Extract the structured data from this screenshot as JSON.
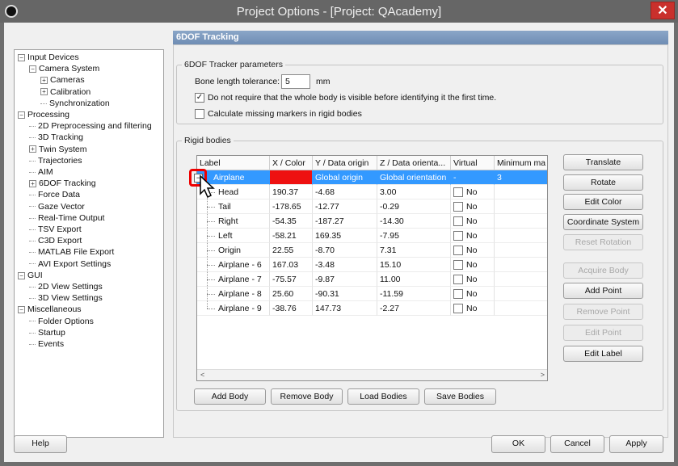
{
  "window": {
    "title": "Project Options - [Project: QAcademy]"
  },
  "panel_header": "6DOF Tracking",
  "tree": {
    "items": [
      {
        "label": "Input Devices",
        "level": 0,
        "exp": "−"
      },
      {
        "label": "Camera System",
        "level": 1,
        "exp": "−"
      },
      {
        "label": "Cameras",
        "level": 2,
        "exp": "+"
      },
      {
        "label": "Calibration",
        "level": 2,
        "exp": "+"
      },
      {
        "label": "Synchronization",
        "level": 2,
        "exp": ""
      },
      {
        "label": "Processing",
        "level": 0,
        "exp": "−"
      },
      {
        "label": "2D Preprocessing and filtering",
        "level": 1,
        "exp": ""
      },
      {
        "label": "3D Tracking",
        "level": 1,
        "exp": ""
      },
      {
        "label": "Twin System",
        "level": 1,
        "exp": "+"
      },
      {
        "label": "Trajectories",
        "level": 1,
        "exp": ""
      },
      {
        "label": "AIM",
        "level": 1,
        "exp": ""
      },
      {
        "label": "6DOF Tracking",
        "level": 1,
        "exp": "+"
      },
      {
        "label": "Force Data",
        "level": 1,
        "exp": ""
      },
      {
        "label": "Gaze Vector",
        "level": 1,
        "exp": ""
      },
      {
        "label": "Real-Time Output",
        "level": 1,
        "exp": ""
      },
      {
        "label": "TSV Export",
        "level": 1,
        "exp": ""
      },
      {
        "label": "C3D Export",
        "level": 1,
        "exp": ""
      },
      {
        "label": "MATLAB File Export",
        "level": 1,
        "exp": ""
      },
      {
        "label": "AVI Export Settings",
        "level": 1,
        "exp": ""
      },
      {
        "label": "GUI",
        "level": 0,
        "exp": "−"
      },
      {
        "label": "2D View Settings",
        "level": 1,
        "exp": ""
      },
      {
        "label": "3D View Settings",
        "level": 1,
        "exp": ""
      },
      {
        "label": "Miscellaneous",
        "level": 0,
        "exp": "−"
      },
      {
        "label": "Folder Options",
        "level": 1,
        "exp": ""
      },
      {
        "label": "Startup",
        "level": 1,
        "exp": ""
      },
      {
        "label": "Events",
        "level": 1,
        "exp": ""
      }
    ]
  },
  "tracker_params": {
    "legend": "6DOF Tracker parameters",
    "bone_label": "Bone length tolerance:",
    "bone_value": "5",
    "bone_unit": "mm",
    "opt1_label": "Do not require that the whole body is visible before identifying it the first time.",
    "opt1_checked": true,
    "opt2_label": "Calculate missing markers in rigid bodies",
    "opt2_checked": false
  },
  "rigid_bodies": {
    "legend": "Rigid bodies",
    "columns": [
      "Label",
      "X / Color",
      "Y / Data origin",
      "Z / Data orienta...",
      "Virtual",
      "Minimum ma"
    ],
    "body": {
      "label": "Airplane",
      "x": "",
      "y": "Global origin",
      "z": "Global orientation",
      "virtual": "-",
      "min": "3",
      "color": "#ee1111"
    },
    "points": [
      {
        "label": "Head",
        "x": "190.37",
        "y": "-4.68",
        "z": "3.00",
        "virtual": "No"
      },
      {
        "label": "Tail",
        "x": "-178.65",
        "y": "-12.77",
        "z": "-0.29",
        "virtual": "No"
      },
      {
        "label": "Right",
        "x": "-54.35",
        "y": "-187.27",
        "z": "-14.30",
        "virtual": "No"
      },
      {
        "label": "Left",
        "x": "-58.21",
        "y": "169.35",
        "z": "-7.95",
        "virtual": "No"
      },
      {
        "label": "Origin",
        "x": "22.55",
        "y": "-8.70",
        "z": "7.31",
        "virtual": "No"
      },
      {
        "label": "Airplane - 6",
        "x": "167.03",
        "y": "-3.48",
        "z": "15.10",
        "virtual": "No"
      },
      {
        "label": "Airplane - 7",
        "x": "-75.57",
        "y": "-9.87",
        "z": "11.00",
        "virtual": "No"
      },
      {
        "label": "Airplane - 8",
        "x": "25.60",
        "y": "-90.31",
        "z": "-11.59",
        "virtual": "No"
      },
      {
        "label": "Airplane - 9",
        "x": "-38.76",
        "y": "147.73",
        "z": "-2.27",
        "virtual": "No"
      }
    ],
    "buttons": {
      "add_body": "Add Body",
      "remove_body": "Remove Body",
      "load_bodies": "Load Bodies",
      "save_bodies": "Save Bodies"
    },
    "side_buttons": {
      "translate": "Translate",
      "rotate": "Rotate",
      "edit_color": "Edit Color",
      "coordinate_system": "Coordinate System",
      "reset_rotation": "Reset Rotation",
      "acquire_body": "Acquire Body",
      "add_point": "Add Point",
      "remove_point": "Remove Point",
      "edit_point": "Edit Point",
      "edit_label": "Edit Label"
    }
  },
  "footer": {
    "help": "Help",
    "ok": "OK",
    "cancel": "Cancel",
    "apply": "Apply"
  }
}
